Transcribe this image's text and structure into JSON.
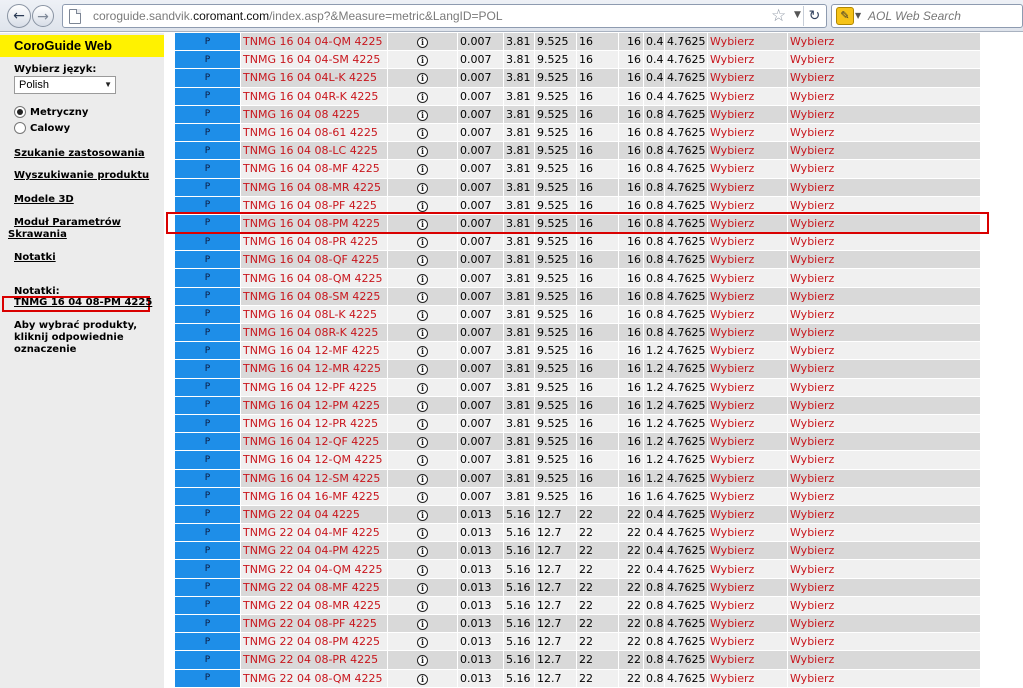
{
  "browser": {
    "url_prefix": "coroguide.sandvik.",
    "url_domain": "coromant.com",
    "url_suffix": "/index.asp?&Measure=metric&LangID=POL",
    "search_placeholder": "AOL Web Search"
  },
  "sidebar": {
    "brand": "CoroGuide Web",
    "language_label": "Wybierz język:",
    "language_value": "Polish",
    "units": [
      {
        "label": "Metryczny",
        "selected": true
      },
      {
        "label": "Calowy",
        "selected": false
      }
    ],
    "links": [
      "Szukanie zastosowania",
      "Wyszukiwanie produktu",
      "Modele 3D"
    ],
    "link_modul_line1": "Moduł Parametrów",
    "link_modul_line2": "Skrawania",
    "link_notatki": "Notatki",
    "notes_label": "Notatki:",
    "notes_value": "TNMG 16 04 08-PM 4225",
    "hint": "Aby wybrać produkty, kliknij odpowiednie oznaczenie"
  },
  "table": {
    "rows": [
      [
        "P",
        "TNMG 16 04 04-QM 4225",
        "0.007",
        "3.81",
        "9.525",
        "16",
        "16",
        "0.4",
        "4.7625",
        "Wybierz",
        "Wybierz"
      ],
      [
        "P",
        "TNMG 16 04 04-SM 4225",
        "0.007",
        "3.81",
        "9.525",
        "16",
        "16",
        "0.4",
        "4.7625",
        "Wybierz",
        "Wybierz"
      ],
      [
        "P",
        "TNMG 16 04 04L-K 4225",
        "0.007",
        "3.81",
        "9.525",
        "16",
        "16",
        "0.4",
        "4.7625",
        "Wybierz",
        "Wybierz"
      ],
      [
        "P",
        "TNMG 16 04 04R-K 4225",
        "0.007",
        "3.81",
        "9.525",
        "16",
        "16",
        "0.4",
        "4.7625",
        "Wybierz",
        "Wybierz"
      ],
      [
        "P",
        "TNMG 16 04 08 4225",
        "0.007",
        "3.81",
        "9.525",
        "16",
        "16",
        "0.8",
        "4.7625",
        "Wybierz",
        "Wybierz"
      ],
      [
        "P",
        "TNMG 16 04 08-61 4225",
        "0.007",
        "3.81",
        "9.525",
        "16",
        "16",
        "0.8",
        "4.7625",
        "Wybierz",
        "Wybierz"
      ],
      [
        "P",
        "TNMG 16 04 08-LC 4225",
        "0.007",
        "3.81",
        "9.525",
        "16",
        "16",
        "0.8",
        "4.7625",
        "Wybierz",
        "Wybierz"
      ],
      [
        "P",
        "TNMG 16 04 08-MF 4225",
        "0.007",
        "3.81",
        "9.525",
        "16",
        "16",
        "0.8",
        "4.7625",
        "Wybierz",
        "Wybierz"
      ],
      [
        "P",
        "TNMG 16 04 08-MR 4225",
        "0.007",
        "3.81",
        "9.525",
        "16",
        "16",
        "0.8",
        "4.7625",
        "Wybierz",
        "Wybierz"
      ],
      [
        "P",
        "TNMG 16 04 08-PF 4225",
        "0.007",
        "3.81",
        "9.525",
        "16",
        "16",
        "0.8",
        "4.7625",
        "Wybierz",
        "Wybierz"
      ],
      [
        "P",
        "TNMG 16 04 08-PM 4225",
        "0.007",
        "3.81",
        "9.525",
        "16",
        "16",
        "0.8",
        "4.7625",
        "Wybierz",
        "Wybierz"
      ],
      [
        "P",
        "TNMG 16 04 08-PR 4225",
        "0.007",
        "3.81",
        "9.525",
        "16",
        "16",
        "0.8",
        "4.7625",
        "Wybierz",
        "Wybierz"
      ],
      [
        "P",
        "TNMG 16 04 08-QF 4225",
        "0.007",
        "3.81",
        "9.525",
        "16",
        "16",
        "0.8",
        "4.7625",
        "Wybierz",
        "Wybierz"
      ],
      [
        "P",
        "TNMG 16 04 08-QM 4225",
        "0.007",
        "3.81",
        "9.525",
        "16",
        "16",
        "0.8",
        "4.7625",
        "Wybierz",
        "Wybierz"
      ],
      [
        "P",
        "TNMG 16 04 08-SM 4225",
        "0.007",
        "3.81",
        "9.525",
        "16",
        "16",
        "0.8",
        "4.7625",
        "Wybierz",
        "Wybierz"
      ],
      [
        "P",
        "TNMG 16 04 08L-K 4225",
        "0.007",
        "3.81",
        "9.525",
        "16",
        "16",
        "0.8",
        "4.7625",
        "Wybierz",
        "Wybierz"
      ],
      [
        "P",
        "TNMG 16 04 08R-K 4225",
        "0.007",
        "3.81",
        "9.525",
        "16",
        "16",
        "0.8",
        "4.7625",
        "Wybierz",
        "Wybierz"
      ],
      [
        "P",
        "TNMG 16 04 12-MF 4225",
        "0.007",
        "3.81",
        "9.525",
        "16",
        "16",
        "1.2",
        "4.7625",
        "Wybierz",
        "Wybierz"
      ],
      [
        "P",
        "TNMG 16 04 12-MR 4225",
        "0.007",
        "3.81",
        "9.525",
        "16",
        "16",
        "1.2",
        "4.7625",
        "Wybierz",
        "Wybierz"
      ],
      [
        "P",
        "TNMG 16 04 12-PF 4225",
        "0.007",
        "3.81",
        "9.525",
        "16",
        "16",
        "1.2",
        "4.7625",
        "Wybierz",
        "Wybierz"
      ],
      [
        "P",
        "TNMG 16 04 12-PM 4225",
        "0.007",
        "3.81",
        "9.525",
        "16",
        "16",
        "1.2",
        "4.7625",
        "Wybierz",
        "Wybierz"
      ],
      [
        "P",
        "TNMG 16 04 12-PR 4225",
        "0.007",
        "3.81",
        "9.525",
        "16",
        "16",
        "1.2",
        "4.7625",
        "Wybierz",
        "Wybierz"
      ],
      [
        "P",
        "TNMG 16 04 12-QF 4225",
        "0.007",
        "3.81",
        "9.525",
        "16",
        "16",
        "1.2",
        "4.7625",
        "Wybierz",
        "Wybierz"
      ],
      [
        "P",
        "TNMG 16 04 12-QM 4225",
        "0.007",
        "3.81",
        "9.525",
        "16",
        "16",
        "1.2",
        "4.7625",
        "Wybierz",
        "Wybierz"
      ],
      [
        "P",
        "TNMG 16 04 12-SM 4225",
        "0.007",
        "3.81",
        "9.525",
        "16",
        "16",
        "1.2",
        "4.7625",
        "Wybierz",
        "Wybierz"
      ],
      [
        "P",
        "TNMG 16 04 16-MF 4225",
        "0.007",
        "3.81",
        "9.525",
        "16",
        "16",
        "1.6",
        "4.7625",
        "Wybierz",
        "Wybierz"
      ],
      [
        "P",
        "TNMG 22 04 04 4225",
        "0.013",
        "5.16",
        "12.7",
        "22",
        "22",
        "0.4",
        "4.7625",
        "Wybierz",
        "Wybierz"
      ],
      [
        "P",
        "TNMG 22 04 04-MF 4225",
        "0.013",
        "5.16",
        "12.7",
        "22",
        "22",
        "0.4",
        "4.7625",
        "Wybierz",
        "Wybierz"
      ],
      [
        "P",
        "TNMG 22 04 04-PM 4225",
        "0.013",
        "5.16",
        "12.7",
        "22",
        "22",
        "0.4",
        "4.7625",
        "Wybierz",
        "Wybierz"
      ],
      [
        "P",
        "TNMG 22 04 04-QM 4225",
        "0.013",
        "5.16",
        "12.7",
        "22",
        "22",
        "0.4",
        "4.7625",
        "Wybierz",
        "Wybierz"
      ],
      [
        "P",
        "TNMG 22 04 08-MF 4225",
        "0.013",
        "5.16",
        "12.7",
        "22",
        "22",
        "0.8",
        "4.7625",
        "Wybierz",
        "Wybierz"
      ],
      [
        "P",
        "TNMG 22 04 08-MR 4225",
        "0.013",
        "5.16",
        "12.7",
        "22",
        "22",
        "0.8",
        "4.7625",
        "Wybierz",
        "Wybierz"
      ],
      [
        "P",
        "TNMG 22 04 08-PF 4225",
        "0.013",
        "5.16",
        "12.7",
        "22",
        "22",
        "0.8",
        "4.7625",
        "Wybierz",
        "Wybierz"
      ],
      [
        "P",
        "TNMG 22 04 08-PM 4225",
        "0.013",
        "5.16",
        "12.7",
        "22",
        "22",
        "0.8",
        "4.7625",
        "Wybierz",
        "Wybierz"
      ],
      [
        "P",
        "TNMG 22 04 08-PR 4225",
        "0.013",
        "5.16",
        "12.7",
        "22",
        "22",
        "0.8",
        "4.7625",
        "Wybierz",
        "Wybierz"
      ],
      [
        "P",
        "TNMG 22 04 08-QM 4225",
        "0.013",
        "5.16",
        "12.7",
        "22",
        "22",
        "0.8",
        "4.7625",
        "Wybierz",
        "Wybierz"
      ]
    ]
  }
}
